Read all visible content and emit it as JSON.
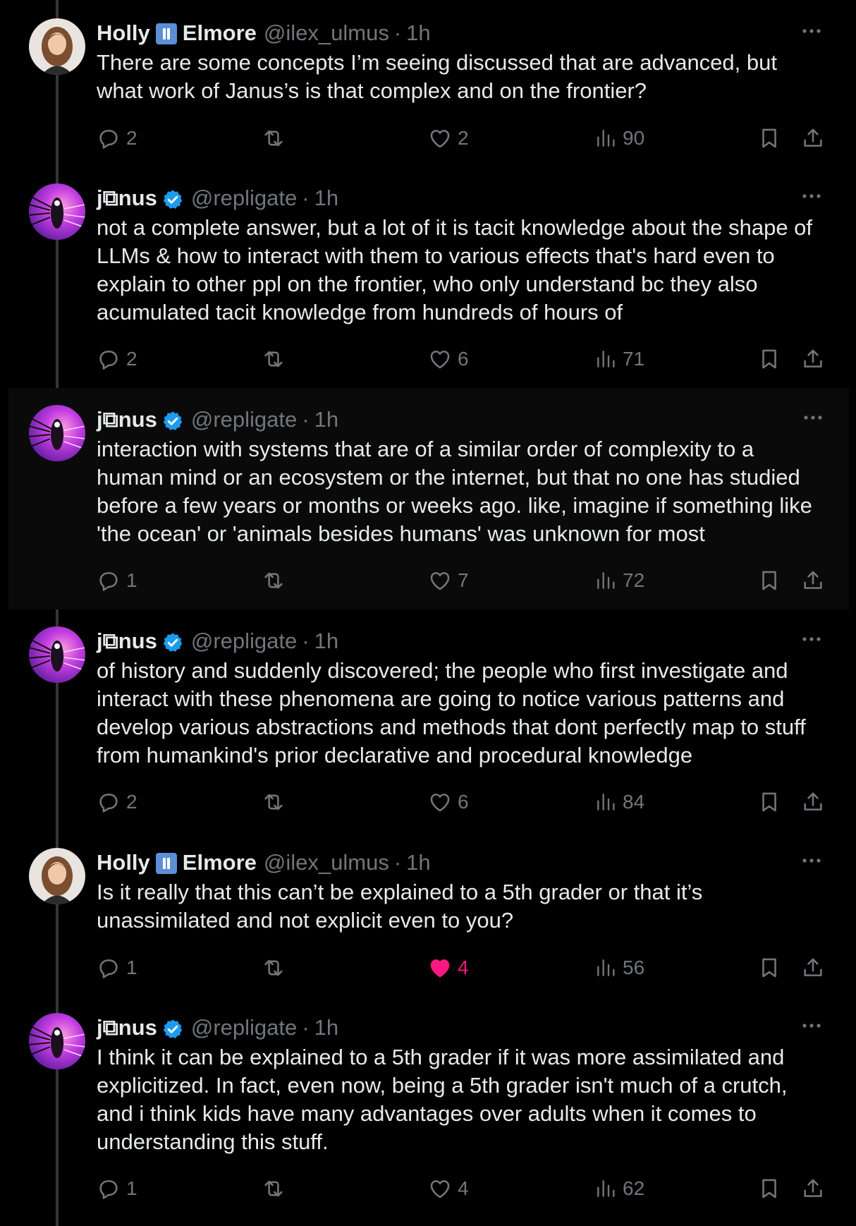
{
  "thread": {
    "tweets": [
      {
        "display_name_first": "Holly",
        "display_name_last": "Elmore",
        "handle": "@ilex_ulmus",
        "separator": "·",
        "time": "1h",
        "text": "There are some concepts I’m seeing discussed that are advanced, but what work of Janus’s is that complex and on the frontier?",
        "replies": "2",
        "retweets": "",
        "likes": "2",
        "views": "90",
        "liked": false
      },
      {
        "display_name": "j⧉nus",
        "verified": true,
        "handle": "@repligate",
        "separator": "·",
        "time": "1h",
        "text": "not a complete answer, but a lot of it is tacit knowledge about the shape of LLMs & how to interact with them to various effects that's hard even to explain to other ppl on the frontier, who only understand bc they also acumulated tacit knowledge from hundreds of hours of",
        "replies": "2",
        "retweets": "",
        "likes": "6",
        "views": "71",
        "liked": false
      },
      {
        "display_name": "j⧉nus",
        "verified": true,
        "handle": "@repligate",
        "separator": "·",
        "time": "1h",
        "text": "interaction with systems that are of a similar order of complexity to a human mind or an ecosystem or the internet, but that no one has studied before a few years or months or weeks ago. like, imagine if something like 'the ocean' or 'animals besides humans' was unknown for most",
        "replies": "1",
        "retweets": "",
        "likes": "7",
        "views": "72",
        "liked": false
      },
      {
        "display_name": "j⧉nus",
        "verified": true,
        "handle": "@repligate",
        "separator": "·",
        "time": "1h",
        "text": "of history and suddenly discovered; the people who first investigate and interact with these phenomena are going to notice various patterns and develop various abstractions and methods that dont perfectly map to stuff from humankind's prior declarative and procedural knowledge",
        "replies": "2",
        "retweets": "",
        "likes": "6",
        "views": "84",
        "liked": false
      },
      {
        "display_name_first": "Holly",
        "display_name_last": "Elmore",
        "handle": "@ilex_ulmus",
        "separator": "·",
        "time": "1h",
        "text": "Is it really that this can’t be explained to a 5th grader or that it’s unassimilated and not explicit even to you?",
        "replies": "1",
        "retweets": "",
        "likes": "4",
        "views": "56",
        "liked": true
      },
      {
        "display_name": "j⧉nus",
        "verified": true,
        "handle": "@repligate",
        "separator": "·",
        "time": "1h",
        "text": "I think it can be explained to a 5th grader if it was more assimilated and explicitized. In fact, even now, being a 5th grader isn't much of a crutch, and i think kids have many advantages over adults when it comes to understanding this stuff.",
        "replies": "1",
        "retweets": "",
        "likes": "4",
        "views": "62",
        "liked": false
      }
    ]
  },
  "colors": {
    "background": "#000000",
    "text": "#e7e9ea",
    "muted": "#71767b",
    "verified": "#1d9bf0",
    "like_active": "#f91880",
    "badge": "#5b8fd6",
    "thread_line": "#333639"
  },
  "icons": [
    "reply-icon",
    "retweet-icon",
    "like-icon",
    "views-icon",
    "bookmark-icon",
    "share-icon",
    "more-icon",
    "verified-icon",
    "pause-badge-icon"
  ]
}
